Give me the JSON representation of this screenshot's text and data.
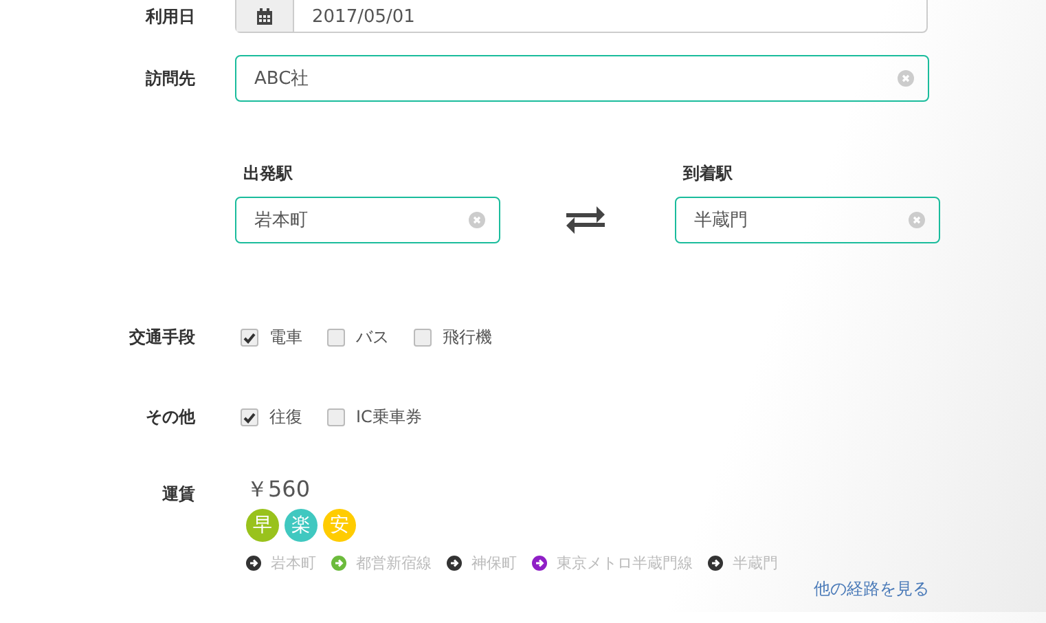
{
  "date": {
    "label": "利用日",
    "value": "2017/05/01"
  },
  "visit": {
    "label": "訪問先",
    "value": "ABC社"
  },
  "stations": [
    {
      "label": "出発駅",
      "value": "岩本町"
    },
    {
      "label": "到着駅",
      "value": "半蔵門"
    }
  ],
  "option_groups": [
    {
      "label": "交通手段",
      "options": [
        {
          "label": "電車",
          "checked": true
        },
        {
          "label": "バス",
          "checked": false
        },
        {
          "label": "飛行機",
          "checked": false
        }
      ]
    },
    {
      "label": "その他",
      "options": [
        {
          "label": "往復",
          "checked": true
        },
        {
          "label": "IC乗車券",
          "checked": false
        }
      ]
    }
  ],
  "fare": {
    "label": "運賃",
    "amount": "￥560",
    "badges": [
      {
        "text": "早",
        "color": "#99c21c"
      },
      {
        "text": "楽",
        "color": "#40c8c0"
      },
      {
        "text": "安",
        "color": "#ffcc00"
      }
    ],
    "route": [
      {
        "text": "岩本町",
        "color": "#333333"
      },
      {
        "text": "都営新宿線",
        "color": "#6cbb3c"
      },
      {
        "text": "神保町",
        "color": "#333333"
      },
      {
        "text": "東京メトロ半蔵門線",
        "color": "#8f1fc6"
      },
      {
        "text": "半蔵門",
        "color": "#333333"
      }
    ],
    "link": "他の経路を見る"
  }
}
